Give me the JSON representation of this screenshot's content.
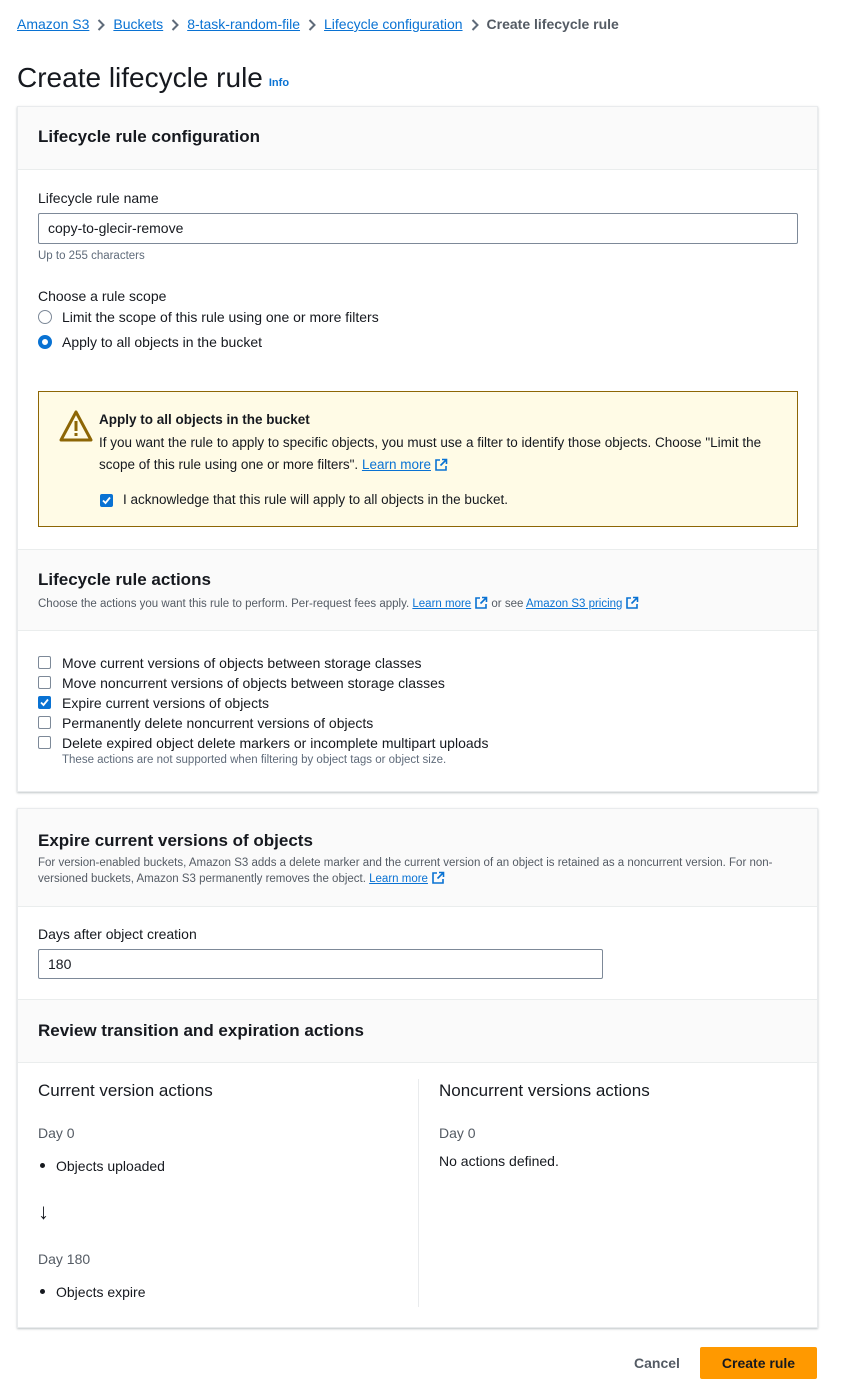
{
  "breadcrumb": {
    "items": [
      "Amazon S3",
      "Buckets",
      "8-task-random-file",
      "Lifecycle configuration"
    ],
    "current": "Create lifecycle rule"
  },
  "page": {
    "title": "Create lifecycle rule",
    "info": "Info"
  },
  "config": {
    "title": "Lifecycle rule configuration",
    "name_label": "Lifecycle rule name",
    "name_value": "copy-to-glecir-remove",
    "name_hint": "Up to 255 characters",
    "scope_label": "Choose a rule scope",
    "scope_options": [
      {
        "label": "Limit the scope of this rule using one or more filters",
        "selected": false
      },
      {
        "label": "Apply to all objects in the bucket",
        "selected": true
      }
    ],
    "alert": {
      "title": "Apply to all objects in the bucket",
      "text": "If you want the rule to apply to specific objects, you must use a filter to identify those objects. Choose \"Limit the scope of this rule using one or more filters\".",
      "link": "Learn more",
      "ack_label": "I acknowledge that this rule will apply to all objects in the bucket.",
      "ack_checked": true
    }
  },
  "actions": {
    "title": "Lifecycle rule actions",
    "desc": "Choose the actions you want this rule to perform. Per-request fees apply.",
    "link1": "Learn more",
    "or_see": "or see",
    "link2": "Amazon S3 pricing",
    "options": [
      {
        "label": "Move current versions of objects between storage classes",
        "checked": false
      },
      {
        "label": "Move noncurrent versions of objects between storage classes",
        "checked": false
      },
      {
        "label": "Expire current versions of objects",
        "checked": true
      },
      {
        "label": "Permanently delete noncurrent versions of objects",
        "checked": false
      },
      {
        "label": "Delete expired object delete markers or incomplete multipart uploads",
        "checked": false
      }
    ],
    "note": "These actions are not supported when filtering by object tags or object size."
  },
  "expire": {
    "title": "Expire current versions of objects",
    "desc": "For version-enabled buckets, Amazon S3 adds a delete marker and the current version of an object is retained as a noncurrent version. For non-versioned buckets, Amazon S3 permanently removes the object.",
    "link": "Learn more",
    "days_label": "Days after object creation",
    "days_value": "180"
  },
  "review": {
    "title": "Review transition and expiration actions",
    "current": {
      "title": "Current version actions",
      "day0": "Day 0",
      "item0": "Objects uploaded",
      "arrow": "↓",
      "day180": "Day 180",
      "item180": "Objects expire"
    },
    "noncurrent": {
      "title": "Noncurrent versions actions",
      "day0": "Day 0",
      "none": "No actions defined."
    }
  },
  "footer": {
    "cancel": "Cancel",
    "create": "Create rule"
  },
  "colors": {
    "link": "#0972d3",
    "primary": "#ff9900",
    "alert_bg": "#fffbe6"
  }
}
